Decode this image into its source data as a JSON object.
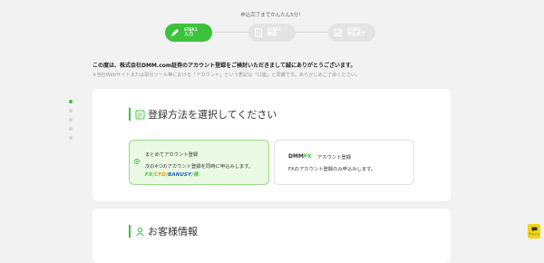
{
  "header": {
    "note": "申込完了までかんたん5分！"
  },
  "steps": [
    {
      "num": "STEP.1",
      "label": "入力",
      "state": "active"
    },
    {
      "num": "STEP.2",
      "label": "確認",
      "state": "inactive"
    },
    {
      "num": "STEP.3",
      "label": "申込完了",
      "state": "inactive"
    }
  ],
  "intro": {
    "text": "この度は、株式会社DMM.com証券のアカウント登録をご検討いただきまして誠にありがとうございます。",
    "note": "※当社Webサイトまたは取引ツール等における「アカウント」という表記は「口座」と同義です。あらかじめご了承ください。"
  },
  "section1": {
    "title": "登録方法を選択してください",
    "options": [
      {
        "title": "まとめてアカウント登録",
        "desc": "次の4つのアカウント登録を同時に申込みします。",
        "brands": [
          "FX",
          "CFD",
          "BANUSY",
          "株"
        ],
        "selected": true
      },
      {
        "logo_main": "DMM",
        "logo_fx": "FX",
        "title": "アカウント登録",
        "desc": "FXのアカウント登録のみ申込みします。",
        "selected": false
      }
    ]
  },
  "section2": {
    "title": "お客様情報"
  },
  "chat": {
    "label": "チャット"
  },
  "colors": {
    "accent": "#3cc33c",
    "accent_light": "#eaf9e3",
    "chat": "#f2d31a"
  }
}
